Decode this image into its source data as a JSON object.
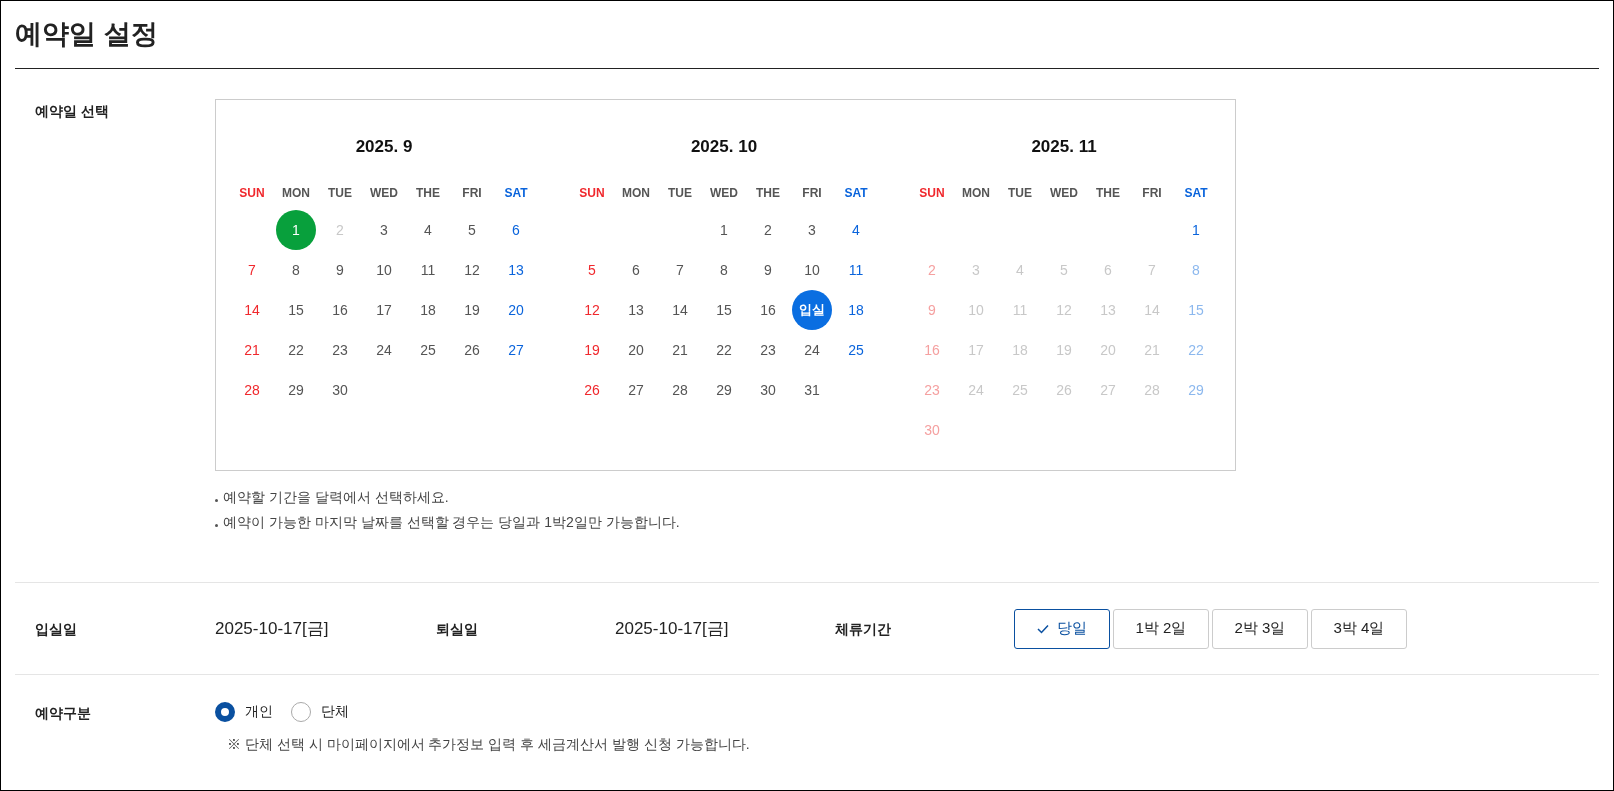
{
  "title": "예약일 설정",
  "date_section": {
    "label": "예약일 선택",
    "months": [
      {
        "title": "2025. 9",
        "weekdays": [
          "SUN",
          "MON",
          "TUE",
          "WED",
          "THE",
          "FRI",
          "SAT"
        ],
        "weeks": [
          [
            {
              "label": "1",
              "disabled": false,
              "today": true,
              "selected": false
            },
            {
              "label": "2",
              "disabled": true,
              "today": false,
              "selected": false
            },
            {
              "label": "3",
              "disabled": false,
              "today": false,
              "selected": false
            },
            {
              "label": "4",
              "disabled": false,
              "today": false,
              "selected": false
            },
            {
              "label": "5",
              "disabled": false,
              "today": false,
              "selected": false
            },
            {
              "label": "6",
              "disabled": false,
              "today": false,
              "selected": false
            }
          ],
          [
            {
              "label": "7",
              "disabled": false,
              "today": false,
              "selected": false
            },
            {
              "label": "8",
              "disabled": false,
              "today": false,
              "selected": false
            },
            {
              "label": "9",
              "disabled": false,
              "today": false,
              "selected": false
            },
            {
              "label": "10",
              "disabled": false,
              "today": false,
              "selected": false
            },
            {
              "label": "11",
              "disabled": false,
              "today": false,
              "selected": false
            },
            {
              "label": "12",
              "disabled": false,
              "today": false,
              "selected": false
            },
            {
              "label": "13",
              "disabled": false,
              "today": false,
              "selected": false
            }
          ],
          [
            {
              "label": "14",
              "disabled": false,
              "today": false,
              "selected": false
            },
            {
              "label": "15",
              "disabled": false,
              "today": false,
              "selected": false
            },
            {
              "label": "16",
              "disabled": false,
              "today": false,
              "selected": false
            },
            {
              "label": "17",
              "disabled": false,
              "today": false,
              "selected": false
            },
            {
              "label": "18",
              "disabled": false,
              "today": false,
              "selected": false
            },
            {
              "label": "19",
              "disabled": false,
              "today": false,
              "selected": false
            },
            {
              "label": "20",
              "disabled": false,
              "today": false,
              "selected": false
            }
          ],
          [
            {
              "label": "21",
              "disabled": false,
              "today": false,
              "selected": false
            },
            {
              "label": "22",
              "disabled": false,
              "today": false,
              "selected": false
            },
            {
              "label": "23",
              "disabled": false,
              "today": false,
              "selected": false
            },
            {
              "label": "24",
              "disabled": false,
              "today": false,
              "selected": false
            },
            {
              "label": "25",
              "disabled": false,
              "today": false,
              "selected": false
            },
            {
              "label": "26",
              "disabled": false,
              "today": false,
              "selected": false
            },
            {
              "label": "27",
              "disabled": false,
              "today": false,
              "selected": false
            }
          ],
          [
            {
              "label": "28",
              "disabled": false,
              "today": false,
              "selected": false
            },
            {
              "label": "29",
              "disabled": false,
              "today": false,
              "selected": false
            },
            {
              "label": "30",
              "disabled": false,
              "today": false,
              "selected": false
            }
          ]
        ]
      },
      {
        "title": "2025. 10",
        "weekdays": [
          "SUN",
          "MON",
          "TUE",
          "WED",
          "THE",
          "FRI",
          "SAT"
        ],
        "weeks": [
          [
            {
              "label": "1",
              "disabled": false,
              "today": false,
              "selected": false
            },
            {
              "label": "2",
              "disabled": false,
              "today": false,
              "selected": false
            },
            {
              "label": "3",
              "disabled": false,
              "today": false,
              "selected": false
            },
            {
              "label": "4",
              "disabled": false,
              "today": false,
              "selected": false
            }
          ],
          [
            {
              "label": "5",
              "disabled": false,
              "today": false,
              "selected": false
            },
            {
              "label": "6",
              "disabled": false,
              "today": false,
              "selected": false
            },
            {
              "label": "7",
              "disabled": false,
              "today": false,
              "selected": false
            },
            {
              "label": "8",
              "disabled": false,
              "today": false,
              "selected": false
            },
            {
              "label": "9",
              "disabled": false,
              "today": false,
              "selected": false
            },
            {
              "label": "10",
              "disabled": false,
              "today": false,
              "selected": false
            },
            {
              "label": "11",
              "disabled": false,
              "today": false,
              "selected": false
            }
          ],
          [
            {
              "label": "12",
              "disabled": false,
              "today": false,
              "selected": false
            },
            {
              "label": "13",
              "disabled": false,
              "today": false,
              "selected": false
            },
            {
              "label": "14",
              "disabled": false,
              "today": false,
              "selected": false
            },
            {
              "label": "15",
              "disabled": false,
              "today": false,
              "selected": false
            },
            {
              "label": "16",
              "disabled": false,
              "today": false,
              "selected": false
            },
            {
              "label": "입실",
              "disabled": false,
              "today": false,
              "selected": true
            },
            {
              "label": "18",
              "disabled": false,
              "today": false,
              "selected": false
            }
          ],
          [
            {
              "label": "19",
              "disabled": false,
              "today": false,
              "selected": false
            },
            {
              "label": "20",
              "disabled": false,
              "today": false,
              "selected": false
            },
            {
              "label": "21",
              "disabled": false,
              "today": false,
              "selected": false
            },
            {
              "label": "22",
              "disabled": false,
              "today": false,
              "selected": false
            },
            {
              "label": "23",
              "disabled": false,
              "today": false,
              "selected": false
            },
            {
              "label": "24",
              "disabled": false,
              "today": false,
              "selected": false
            },
            {
              "label": "25",
              "disabled": false,
              "today": false,
              "selected": false
            }
          ],
          [
            {
              "label": "26",
              "disabled": false,
              "today": false,
              "selected": false
            },
            {
              "label": "27",
              "disabled": false,
              "today": false,
              "selected": false
            },
            {
              "label": "28",
              "disabled": false,
              "today": false,
              "selected": false
            },
            {
              "label": "29",
              "disabled": false,
              "today": false,
              "selected": false
            },
            {
              "label": "30",
              "disabled": false,
              "today": false,
              "selected": false
            },
            {
              "label": "31",
              "disabled": false,
              "today": false,
              "selected": false
            }
          ]
        ]
      },
      {
        "title": "2025. 11",
        "weekdays": [
          "SUN",
          "MON",
          "TUE",
          "WED",
          "THE",
          "FRI",
          "SAT"
        ],
        "weeks": [
          [
            {
              "label": "1",
              "disabled": false,
              "today": false,
              "selected": false
            }
          ],
          [
            {
              "label": "2",
              "disabled": true,
              "today": false,
              "selected": false
            },
            {
              "label": "3",
              "disabled": true,
              "today": false,
              "selected": false
            },
            {
              "label": "4",
              "disabled": true,
              "today": false,
              "selected": false
            },
            {
              "label": "5",
              "disabled": true,
              "today": false,
              "selected": false
            },
            {
              "label": "6",
              "disabled": true,
              "today": false,
              "selected": false
            },
            {
              "label": "7",
              "disabled": true,
              "today": false,
              "selected": false
            },
            {
              "label": "8",
              "disabled": true,
              "today": false,
              "selected": false
            }
          ],
          [
            {
              "label": "9",
              "disabled": true,
              "today": false,
              "selected": false
            },
            {
              "label": "10",
              "disabled": true,
              "today": false,
              "selected": false
            },
            {
              "label": "11",
              "disabled": true,
              "today": false,
              "selected": false
            },
            {
              "label": "12",
              "disabled": true,
              "today": false,
              "selected": false
            },
            {
              "label": "13",
              "disabled": true,
              "today": false,
              "selected": false
            },
            {
              "label": "14",
              "disabled": true,
              "today": false,
              "selected": false
            },
            {
              "label": "15",
              "disabled": true,
              "today": false,
              "selected": false
            }
          ],
          [
            {
              "label": "16",
              "disabled": true,
              "today": false,
              "selected": false
            },
            {
              "label": "17",
              "disabled": true,
              "today": false,
              "selected": false
            },
            {
              "label": "18",
              "disabled": true,
              "today": false,
              "selected": false
            },
            {
              "label": "19",
              "disabled": true,
              "today": false,
              "selected": false
            },
            {
              "label": "20",
              "disabled": true,
              "today": false,
              "selected": false
            },
            {
              "label": "21",
              "disabled": true,
              "today": false,
              "selected": false
            },
            {
              "label": "22",
              "disabled": true,
              "today": false,
              "selected": false
            }
          ],
          [
            {
              "label": "23",
              "disabled": true,
              "today": false,
              "selected": false
            },
            {
              "label": "24",
              "disabled": true,
              "today": false,
              "selected": false
            },
            {
              "label": "25",
              "disabled": true,
              "today": false,
              "selected": false
            },
            {
              "label": "26",
              "disabled": true,
              "today": false,
              "selected": false
            },
            {
              "label": "27",
              "disabled": true,
              "today": false,
              "selected": false
            },
            {
              "label": "28",
              "disabled": true,
              "today": false,
              "selected": false
            },
            {
              "label": "29",
              "disabled": true,
              "today": false,
              "selected": false
            }
          ],
          [
            {
              "label": "30",
              "disabled": true,
              "today": false,
              "selected": false
            }
          ]
        ]
      }
    ],
    "notes": [
      "예약할 기간을 달력에서 선택하세요.",
      "예약이 가능한 마지막 날짜를 선택할 경우는 당일과 1박2일만 가능합니다."
    ]
  },
  "stay": {
    "checkin_label": "입실일",
    "checkin": "2025-10-17[금]",
    "checkout_label": "퇴실일",
    "checkout": "2025-10-17[금]",
    "period_label": "체류기간",
    "periods": [
      {
        "label": "당일",
        "selected": true
      },
      {
        "label": "1박 2일",
        "selected": false
      },
      {
        "label": "2박 3일",
        "selected": false
      },
      {
        "label": "3박 4일",
        "selected": false
      }
    ]
  },
  "type_section": {
    "label": "예약구분",
    "options": [
      {
        "label": "개인",
        "selected": true
      },
      {
        "label": "단체",
        "selected": false
      }
    ],
    "note": "※ 단체 선택 시 마이페이지에서 추가정보 입력 후 세금계산서 발행 신청 가능합니다."
  }
}
